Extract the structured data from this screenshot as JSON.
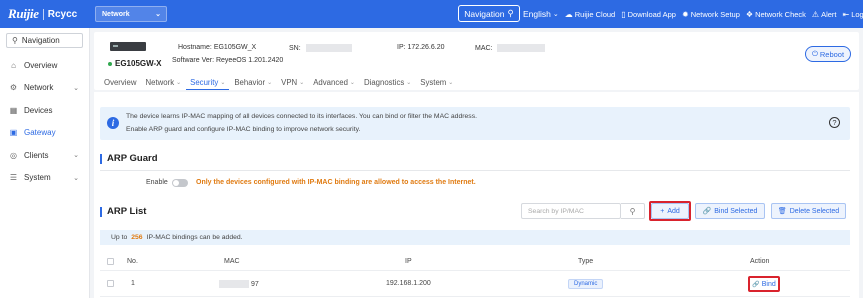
{
  "brand": {
    "ruijie": "Ruijie",
    "rcycc": "Rcycc"
  },
  "topbar": {
    "network_select": "Network",
    "navigation_btn": "Navigation",
    "language": "English",
    "items": {
      "cloud": "Ruijie Cloud",
      "download": "Download App",
      "setup": "Network Setup",
      "check": "Network Check",
      "alert": "Alert",
      "logout": "Log Out"
    }
  },
  "sidebar": {
    "search_label": "Navigation",
    "items": {
      "overview": "Overview",
      "network": "Network",
      "devices": "Devices",
      "gateway": "Gateway",
      "clients": "Clients",
      "system": "System"
    }
  },
  "device": {
    "model": "EG105GW-X",
    "image_label": "Reyee",
    "hostname_label": "Hostname:",
    "hostname": "EG105GW_X",
    "software_label": "Software Ver:",
    "software": "ReyeeOS 1.201.2420",
    "sn_label": "SN:",
    "ip_label": "IP:",
    "ip": "172.26.6.20",
    "mac_label": "MAC:",
    "reboot": "Reboot"
  },
  "tabs": {
    "overview": "Overview",
    "network": "Network",
    "security": "Security",
    "behavior": "Behavior",
    "vpn": "VPN",
    "advanced": "Advanced",
    "diagnostics": "Diagnostics",
    "system": "System"
  },
  "info": {
    "line1": "The device learns IP-MAC mapping of all devices connected to its interfaces. You can bind or filter the MAC address.",
    "line2": "Enable ARP guard and configure IP-MAC binding to improve network security."
  },
  "arp_guard": {
    "title": "ARP Guard",
    "enable_label": "Enable",
    "enabled": false,
    "warning": "Only the devices configured with IP-MAC binding are allowed to access the Internet."
  },
  "arp_list": {
    "title": "ARP List",
    "search_placeholder": "Search by IP/MAC",
    "add": "Add",
    "bind_selected": "Bind Selected",
    "delete_selected": "Delete Selected",
    "capacity_prefix": "Up to",
    "capacity_num": "256",
    "capacity_suffix": "IP-MAC bindings can be added.",
    "columns": {
      "no": "No.",
      "mac": "MAC",
      "ip": "IP",
      "type": "Type",
      "action": "Action"
    },
    "rows": [
      {
        "no": "1",
        "mac_suffix": "97",
        "ip": "192.168.1.200",
        "type": "Dynamic",
        "action": "Bind"
      }
    ]
  },
  "colors": {
    "accent": "#2d6ae3",
    "warning": "#e07b12",
    "highlight": "#d9232d"
  }
}
